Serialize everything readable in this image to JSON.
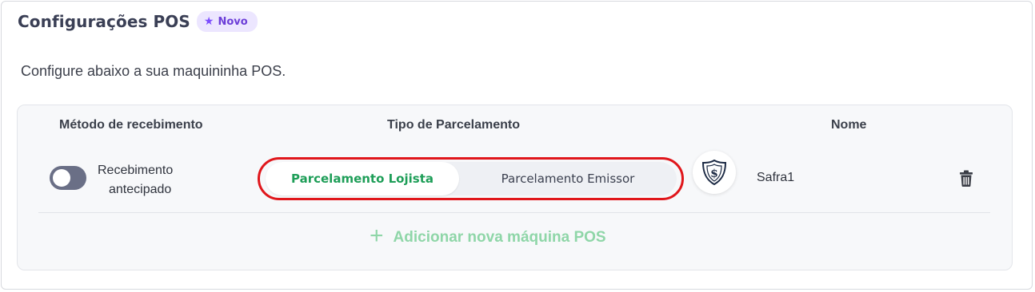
{
  "header": {
    "title": "Configurações POS",
    "badge": "Novo",
    "badge_icon": "star-icon"
  },
  "subtitle": "Configure abaixo a sua maquininha POS.",
  "table": {
    "columns": [
      "Método de recebimento",
      "Tipo de Parcelamento",
      "Nome"
    ]
  },
  "row": {
    "toggle_label_line1": "Recebimento",
    "toggle_label_line2": "antecipado",
    "toggle_on": false,
    "installment_options": [
      "Parcelamento Lojista",
      "Parcelamento Emissor"
    ],
    "selected_option": "Parcelamento Lojista",
    "name": "Safra1",
    "logo_icon": "safra-bank-logo",
    "delete_icon": "trash-icon"
  },
  "add_button": {
    "label": "Adicionar nova máquina POS",
    "icon": "plus-icon"
  },
  "colors": {
    "accent_green": "#1e9e58",
    "add_button_green": "#8fd6a8",
    "badge_purple": "#6c3ed8",
    "highlight_red": "#e0161b"
  }
}
